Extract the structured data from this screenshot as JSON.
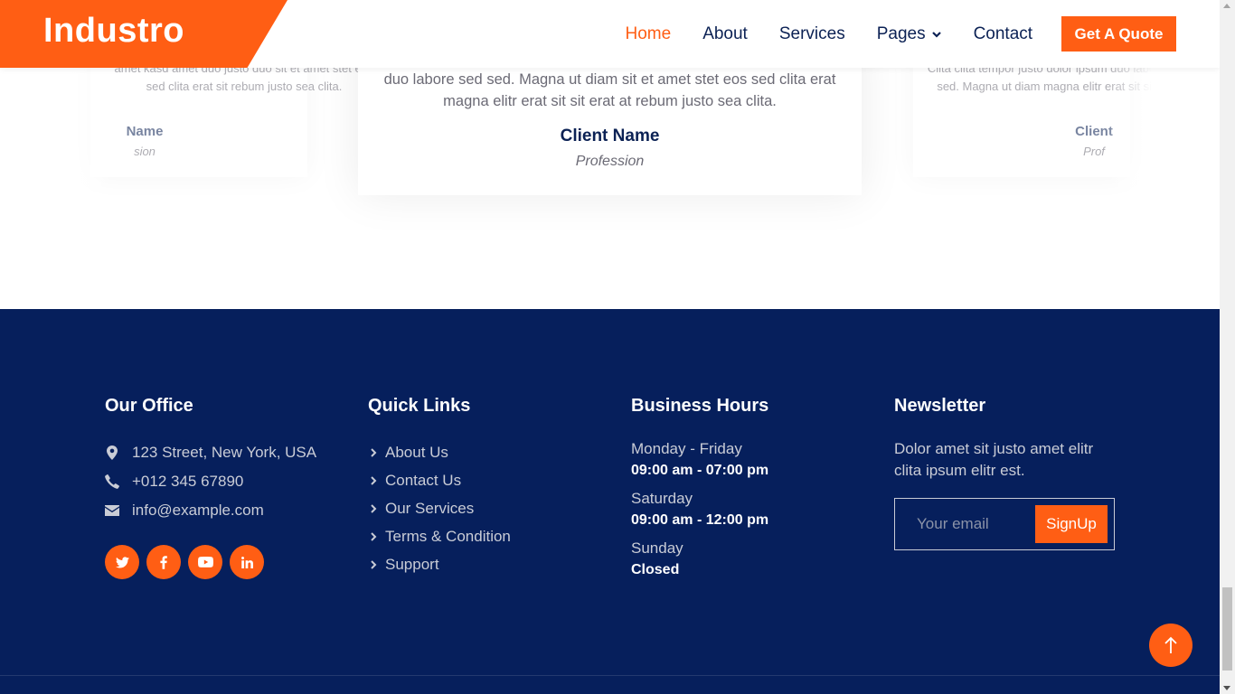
{
  "navbar": {
    "brand": "Industro",
    "links": [
      {
        "label": "Home",
        "active": true
      },
      {
        "label": "About",
        "active": false
      },
      {
        "label": "Services",
        "active": false
      },
      {
        "label": "Pages",
        "active": false,
        "dropdown": true
      },
      {
        "label": "Contact",
        "active": false
      }
    ],
    "quote_button": "Get A Quote"
  },
  "testimonials": {
    "center": {
      "quote": "duo labore sed sed. Magna ut diam sit et amet stet eos sed clita erat magna elitr erat sit sit erat at rebum justo sea clita.",
      "name": "Client Name",
      "profession": "Profession"
    },
    "left": {
      "quote": "amet kasd amet duo justo duo sit et amet stet eos sed clita erat sit rebum justo sea clita.",
      "name": "Name",
      "profession": "sion"
    },
    "right": {
      "quote": "Clita clita tempor justo dolor ipsum duo labore sed sed. Magna ut diam magna elitr erat sit sit erat",
      "name": "Client",
      "profession": "Prof"
    }
  },
  "footer": {
    "office": {
      "title": "Our Office",
      "address": "123 Street, New York, USA",
      "phone": "+012 345 67890",
      "email": "info@example.com",
      "socials": [
        "twitter-icon",
        "facebook-icon",
        "youtube-icon",
        "linkedin-icon"
      ]
    },
    "quick_links": {
      "title": "Quick Links",
      "items": [
        "About Us",
        "Contact Us",
        "Our Services",
        "Terms & Condition",
        "Support"
      ]
    },
    "hours": {
      "title": "Business Hours",
      "rows": [
        {
          "day": "Monday - Friday",
          "time": "09:00 am - 07:00 pm"
        },
        {
          "day": "Saturday",
          "time": "09:00 am - 12:00 pm"
        },
        {
          "day": "Sunday",
          "time": "Closed"
        }
      ]
    },
    "newsletter": {
      "title": "Newsletter",
      "text": "Dolor amet sit justo amet elitr clita ipsum elitr est.",
      "placeholder": "Your email",
      "button": "SignUp"
    }
  },
  "colors": {
    "accent": "#ff5e14",
    "navy": "#061f5c",
    "heading": "#0b2154"
  }
}
